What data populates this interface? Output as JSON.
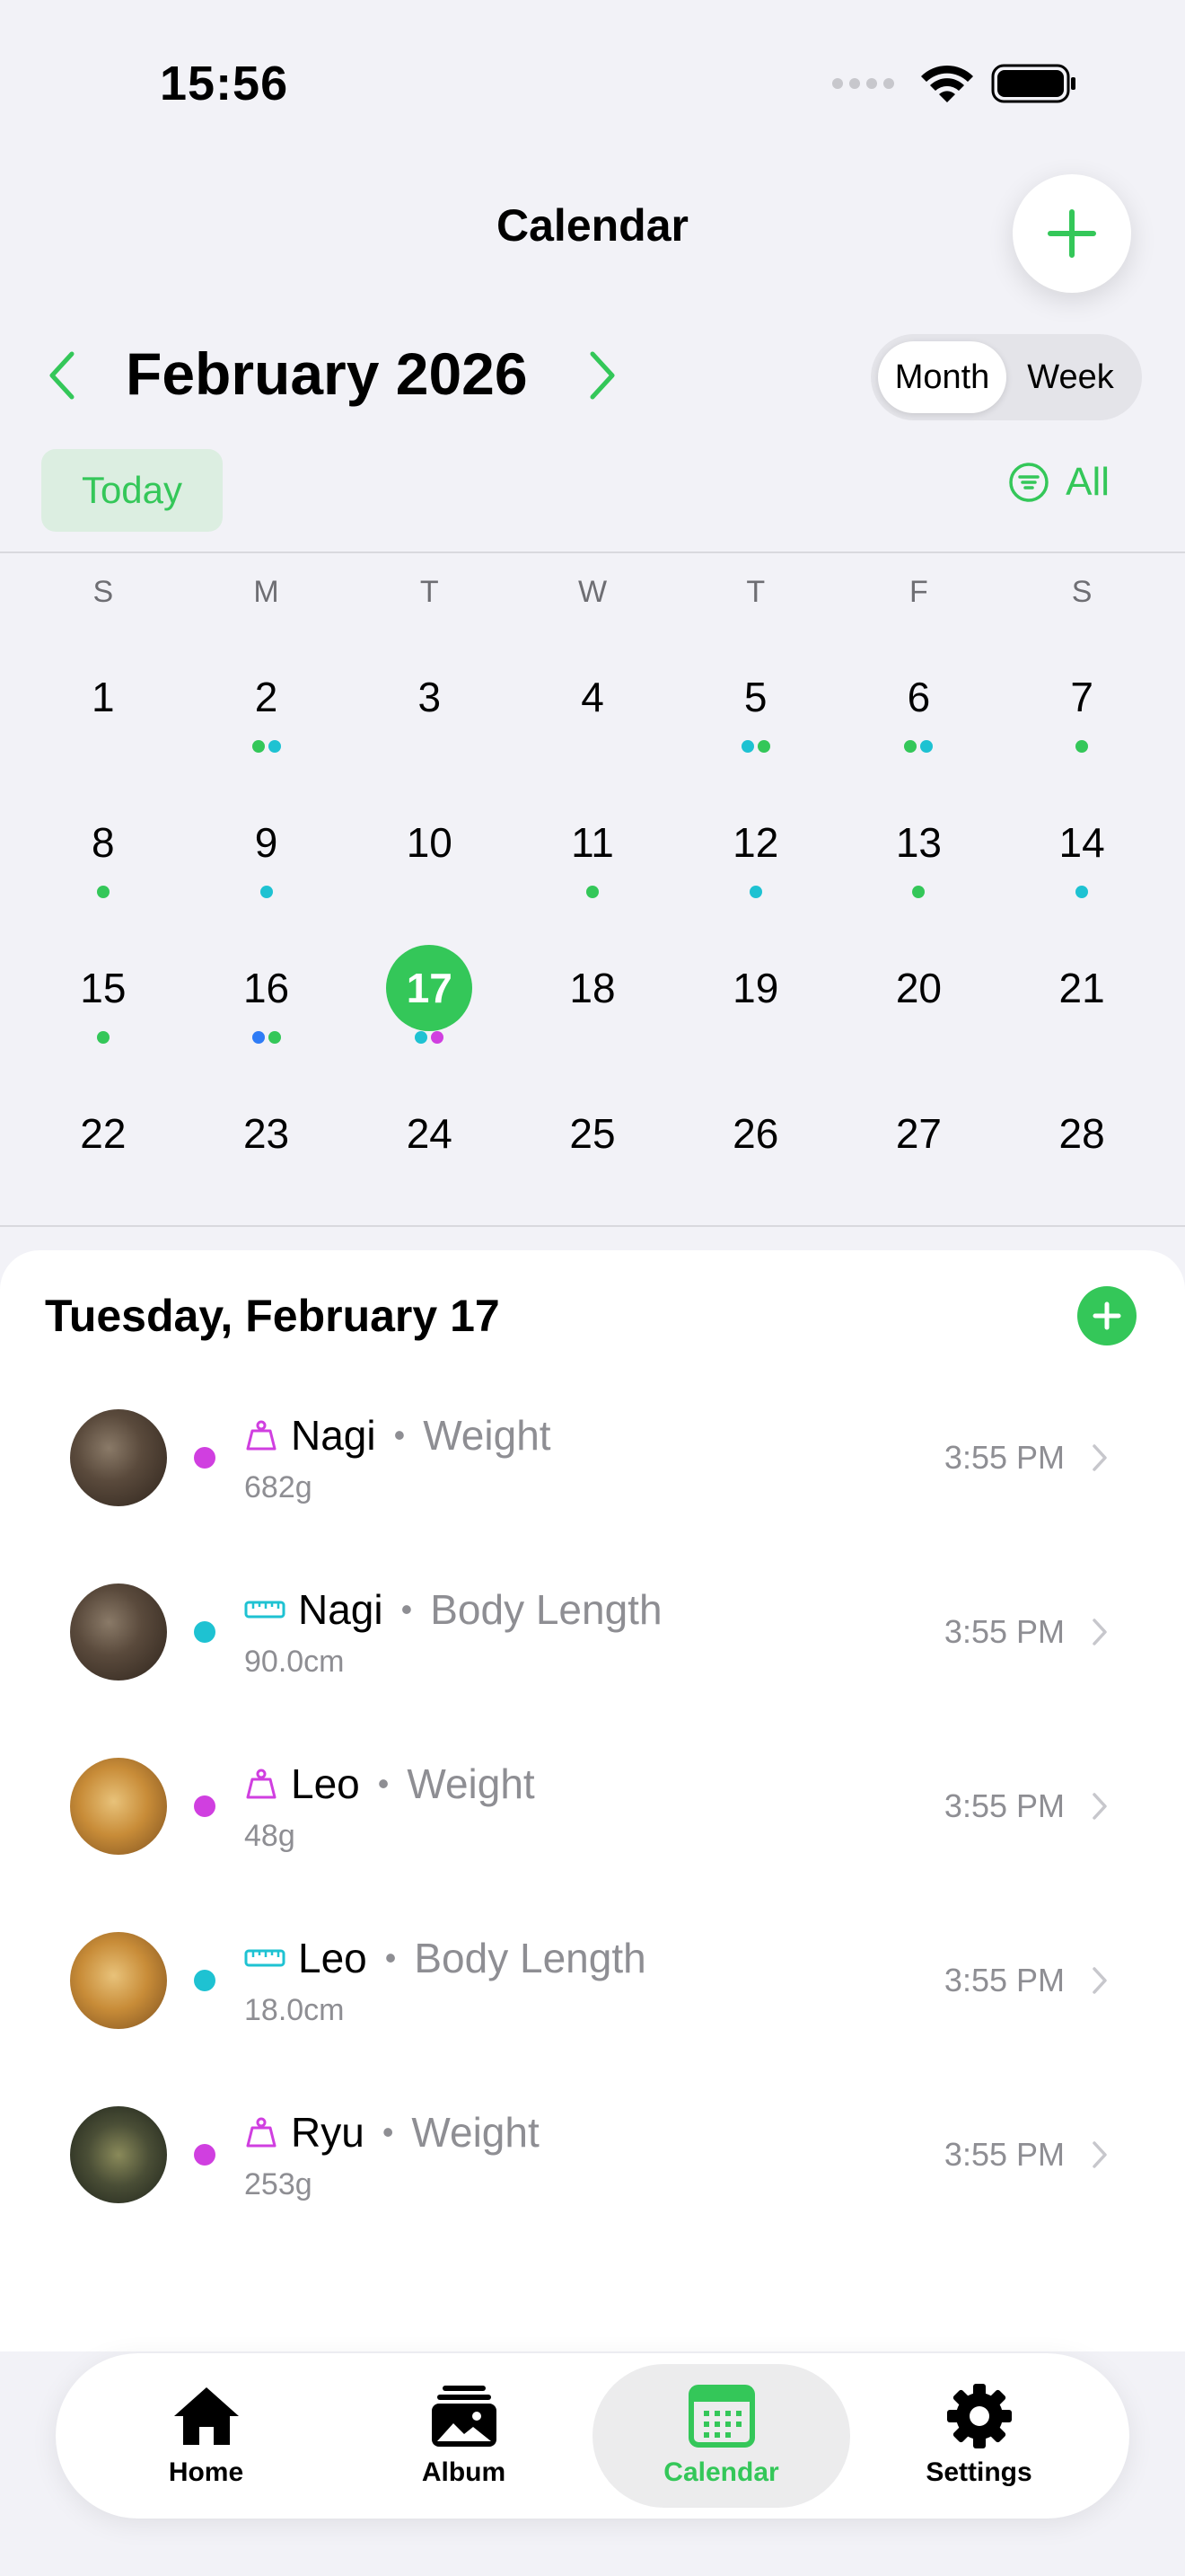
{
  "status_bar": {
    "time": "15:56"
  },
  "header": {
    "title": "Calendar"
  },
  "month_nav": {
    "title": "February 2026",
    "view_options": [
      "Month",
      "Week"
    ],
    "selected_view": "Month"
  },
  "toolbar": {
    "today_label": "Today",
    "filter_label": "All"
  },
  "calendar": {
    "weekdays": [
      "S",
      "M",
      "T",
      "W",
      "T",
      "F",
      "S"
    ],
    "selected_day": 17,
    "days": [
      {
        "d": "1",
        "dots": []
      },
      {
        "d": "2",
        "dots": [
          "green",
          "cyan"
        ]
      },
      {
        "d": "3",
        "dots": []
      },
      {
        "d": "4",
        "dots": []
      },
      {
        "d": "5",
        "dots": [
          "cyan",
          "green"
        ]
      },
      {
        "d": "6",
        "dots": [
          "green",
          "cyan"
        ]
      },
      {
        "d": "7",
        "dots": [
          "green"
        ]
      },
      {
        "d": "8",
        "dots": [
          "green"
        ]
      },
      {
        "d": "9",
        "dots": [
          "cyan"
        ]
      },
      {
        "d": "10",
        "dots": []
      },
      {
        "d": "11",
        "dots": [
          "green"
        ]
      },
      {
        "d": "12",
        "dots": [
          "cyan"
        ]
      },
      {
        "d": "13",
        "dots": [
          "green"
        ]
      },
      {
        "d": "14",
        "dots": [
          "cyan"
        ]
      },
      {
        "d": "15",
        "dots": [
          "green"
        ]
      },
      {
        "d": "16",
        "dots": [
          "blue",
          "green"
        ]
      },
      {
        "d": "17",
        "dots": [
          "cyan",
          "purple"
        ]
      },
      {
        "d": "18",
        "dots": []
      },
      {
        "d": "19",
        "dots": []
      },
      {
        "d": "20",
        "dots": []
      },
      {
        "d": "21",
        "dots": []
      },
      {
        "d": "22",
        "dots": []
      },
      {
        "d": "23",
        "dots": []
      },
      {
        "d": "24",
        "dots": []
      },
      {
        "d": "25",
        "dots": []
      },
      {
        "d": "26",
        "dots": []
      },
      {
        "d": "27",
        "dots": []
      },
      {
        "d": "28",
        "dots": []
      }
    ],
    "colors": {
      "green": "#34c759",
      "cyan": "#1ec2d2",
      "blue": "#2f7cf6",
      "purple": "#d03fe0"
    }
  },
  "events_section": {
    "title": "Tuesday, February 17",
    "events": [
      {
        "name": "Nagi",
        "type": "Weight",
        "value": "682g",
        "time": "3:55 PM",
        "kind": "weight",
        "color": "#d03fe0",
        "avatar": "dark"
      },
      {
        "name": "Nagi",
        "type": "Body Length",
        "value": "90.0cm",
        "time": "3:55 PM",
        "kind": "length",
        "color": "#1ec2d2",
        "avatar": "dark"
      },
      {
        "name": "Leo",
        "type": "Weight",
        "value": "48g",
        "time": "3:55 PM",
        "kind": "weight",
        "color": "#d03fe0",
        "avatar": "gold"
      },
      {
        "name": "Leo",
        "type": "Body Length",
        "value": "18.0cm",
        "time": "3:55 PM",
        "kind": "length",
        "color": "#1ec2d2",
        "avatar": "gold"
      },
      {
        "name": "Ryu",
        "type": "Weight",
        "value": "253g",
        "time": "3:55 PM",
        "kind": "weight",
        "color": "#d03fe0",
        "avatar": "green"
      }
    ]
  },
  "tabbar": {
    "items": [
      {
        "label": "Home",
        "icon": "house-icon"
      },
      {
        "label": "Album",
        "icon": "photo-stack-icon"
      },
      {
        "label": "Calendar",
        "icon": "calendar-icon"
      },
      {
        "label": "Settings",
        "icon": "gear-icon"
      }
    ],
    "active": "Calendar"
  },
  "accent_color": "#34c759"
}
